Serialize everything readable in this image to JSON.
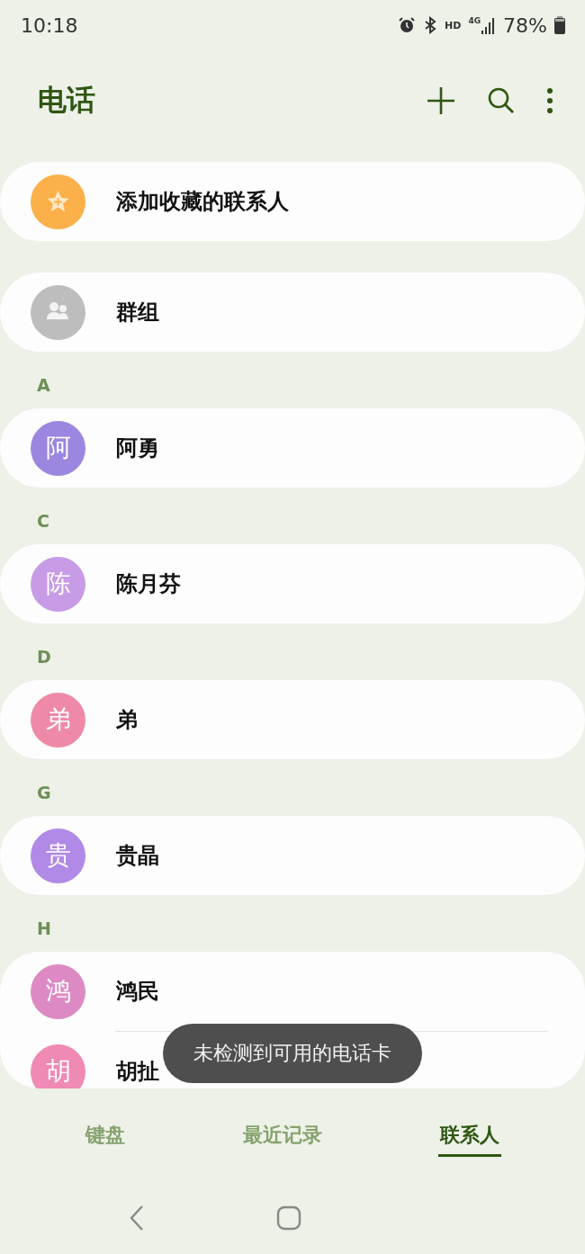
{
  "status_bar": {
    "time": "10:18",
    "battery": "78%",
    "network": "4G",
    "hd": "HD"
  },
  "header": {
    "title": "电话"
  },
  "favorites": {
    "label": "添加收藏的联系人"
  },
  "groups": {
    "label": "群组"
  },
  "sections": [
    {
      "letter": "A",
      "contacts": [
        {
          "avatar": "阿",
          "name": "阿勇",
          "color": "#9b86e0"
        }
      ]
    },
    {
      "letter": "C",
      "contacts": [
        {
          "avatar": "陈",
          "name": "陈月芬",
          "color": "#c79be6"
        }
      ]
    },
    {
      "letter": "D",
      "contacts": [
        {
          "avatar": "弟",
          "name": "弟",
          "color": "#ee8aa8"
        }
      ]
    },
    {
      "letter": "G",
      "contacts": [
        {
          "avatar": "贵",
          "name": "贵晶",
          "color": "#b08ae6"
        }
      ]
    },
    {
      "letter": "H",
      "contacts": [
        {
          "avatar": "鸿",
          "name": "鸿民",
          "color": "#dd8ac4"
        },
        {
          "avatar": "胡",
          "name": "胡扯",
          "color": "#ee8ab4"
        }
      ]
    }
  ],
  "toast": "未检测到可用的电话卡",
  "tabs": [
    {
      "label": "键盘",
      "selected": false
    },
    {
      "label": "最近记录",
      "selected": false
    },
    {
      "label": "联系人",
      "selected": true
    }
  ]
}
